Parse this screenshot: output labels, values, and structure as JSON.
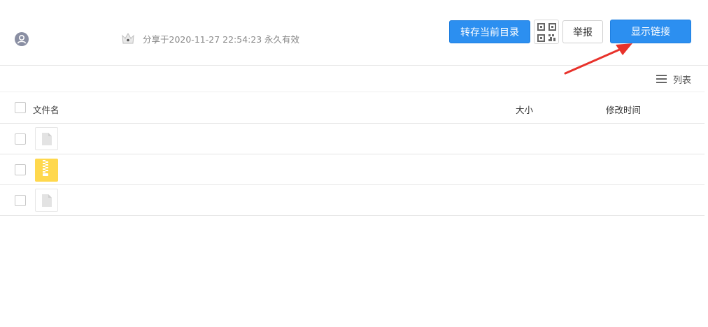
{
  "header": {
    "share_time": "分享于2020-11-27 22:54:23",
    "validity": "永久有效",
    "save_button": "转存当前目录",
    "report_button": "举报",
    "show_link_button": "显示链接"
  },
  "toolbar": {
    "view_mode": "列表"
  },
  "table": {
    "columns": {
      "name": "文件名",
      "size": "大小",
      "modified": "修改时间"
    },
    "rows": [
      {
        "type": "file",
        "icon": "document-icon"
      },
      {
        "type": "zip",
        "icon": "zip-archive-icon"
      },
      {
        "type": "file",
        "icon": "document-icon"
      }
    ]
  },
  "colors": {
    "primary": "#2c8ff0",
    "annotation_arrow": "#e8322b",
    "zip_icon": "#ffd84d"
  }
}
